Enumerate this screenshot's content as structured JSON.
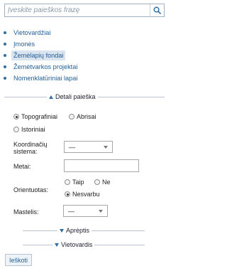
{
  "search": {
    "placeholder": "Įveskite paieškos frazę",
    "value": ""
  },
  "nav": {
    "items": [
      {
        "label": "Vietovardžiai",
        "active": false
      },
      {
        "label": "Įmonės",
        "active": false
      },
      {
        "label": "Žemėlapių fondai",
        "active": true
      },
      {
        "label": "Žemėtvarkos projektai",
        "active": false
      },
      {
        "label": "Nomenklatūriniai lapai",
        "active": false
      }
    ]
  },
  "detail": {
    "title": "Detali paieška",
    "type_options": [
      {
        "label": "Topografiniai",
        "checked": true
      },
      {
        "label": "Abrisai",
        "checked": false
      },
      {
        "label": "Istoriniai",
        "checked": false
      }
    ],
    "coord_label": "Koordinačių sistema:",
    "coord_value": "—",
    "year_label": "Metai:",
    "year_value": "",
    "orient_label": "Orientuotas:",
    "orient_options": [
      {
        "label": "Taip",
        "checked": false
      },
      {
        "label": "Ne",
        "checked": false
      },
      {
        "label": "Nesvarbu",
        "checked": true
      }
    ],
    "scale_label": "Mastelis:",
    "scale_value": "—"
  },
  "sections": {
    "scope": "Aprėptis",
    "place": "Vietovardis"
  },
  "actions": {
    "search_button": "Ieškoti"
  },
  "colors": {
    "link": "#1f5f99",
    "accent": "#2e6da4",
    "active_bg": "#d9e4ee"
  }
}
